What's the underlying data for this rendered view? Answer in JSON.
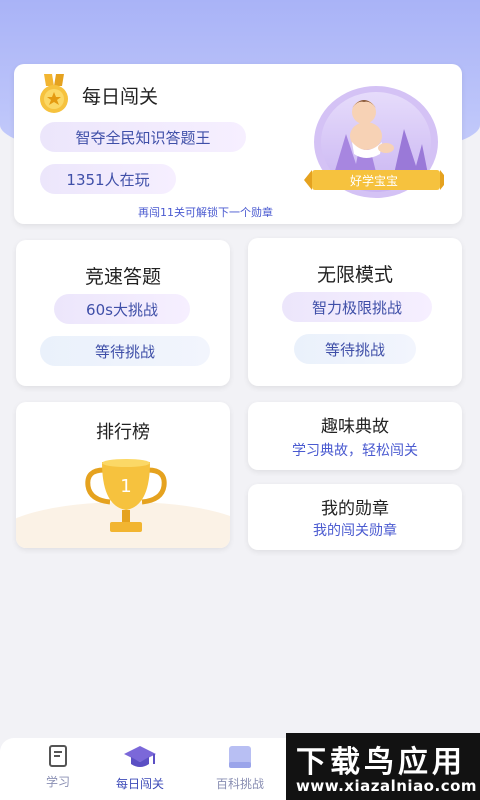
{
  "daily": {
    "title": "每日闯关",
    "pill1": "智夺全民知识答题王",
    "pill2": "1351人在玩",
    "progress": "再闯11关可解锁下一个勋章",
    "badge_label": "好学宝宝"
  },
  "speed": {
    "title": "竞速答题",
    "pill1": "60s大挑战",
    "pill2": "等待挑战"
  },
  "unlimited": {
    "title": "无限模式",
    "pill1": "智力极限挑战",
    "pill2": "等待挑战"
  },
  "ranking": {
    "title": "排行榜"
  },
  "stories": {
    "title": "趣味典故",
    "subtitle": "学习典故，轻松闯关"
  },
  "medals": {
    "title": "我的勋章",
    "subtitle": "我的闯关勋章"
  },
  "tabs": [
    {
      "label": "学习",
      "icon": "book-icon"
    },
    {
      "label": "每日闯关",
      "icon": "graduation-cap-icon"
    },
    {
      "label": "百科挑战",
      "icon": "encyclopedia-icon"
    }
  ],
  "watermark": {
    "line1": "下载鸟应用",
    "line2": "www.xiazalniao.com"
  },
  "colors": {
    "accent": "#3d4bb8",
    "header_bg": "#a9b3f7"
  }
}
